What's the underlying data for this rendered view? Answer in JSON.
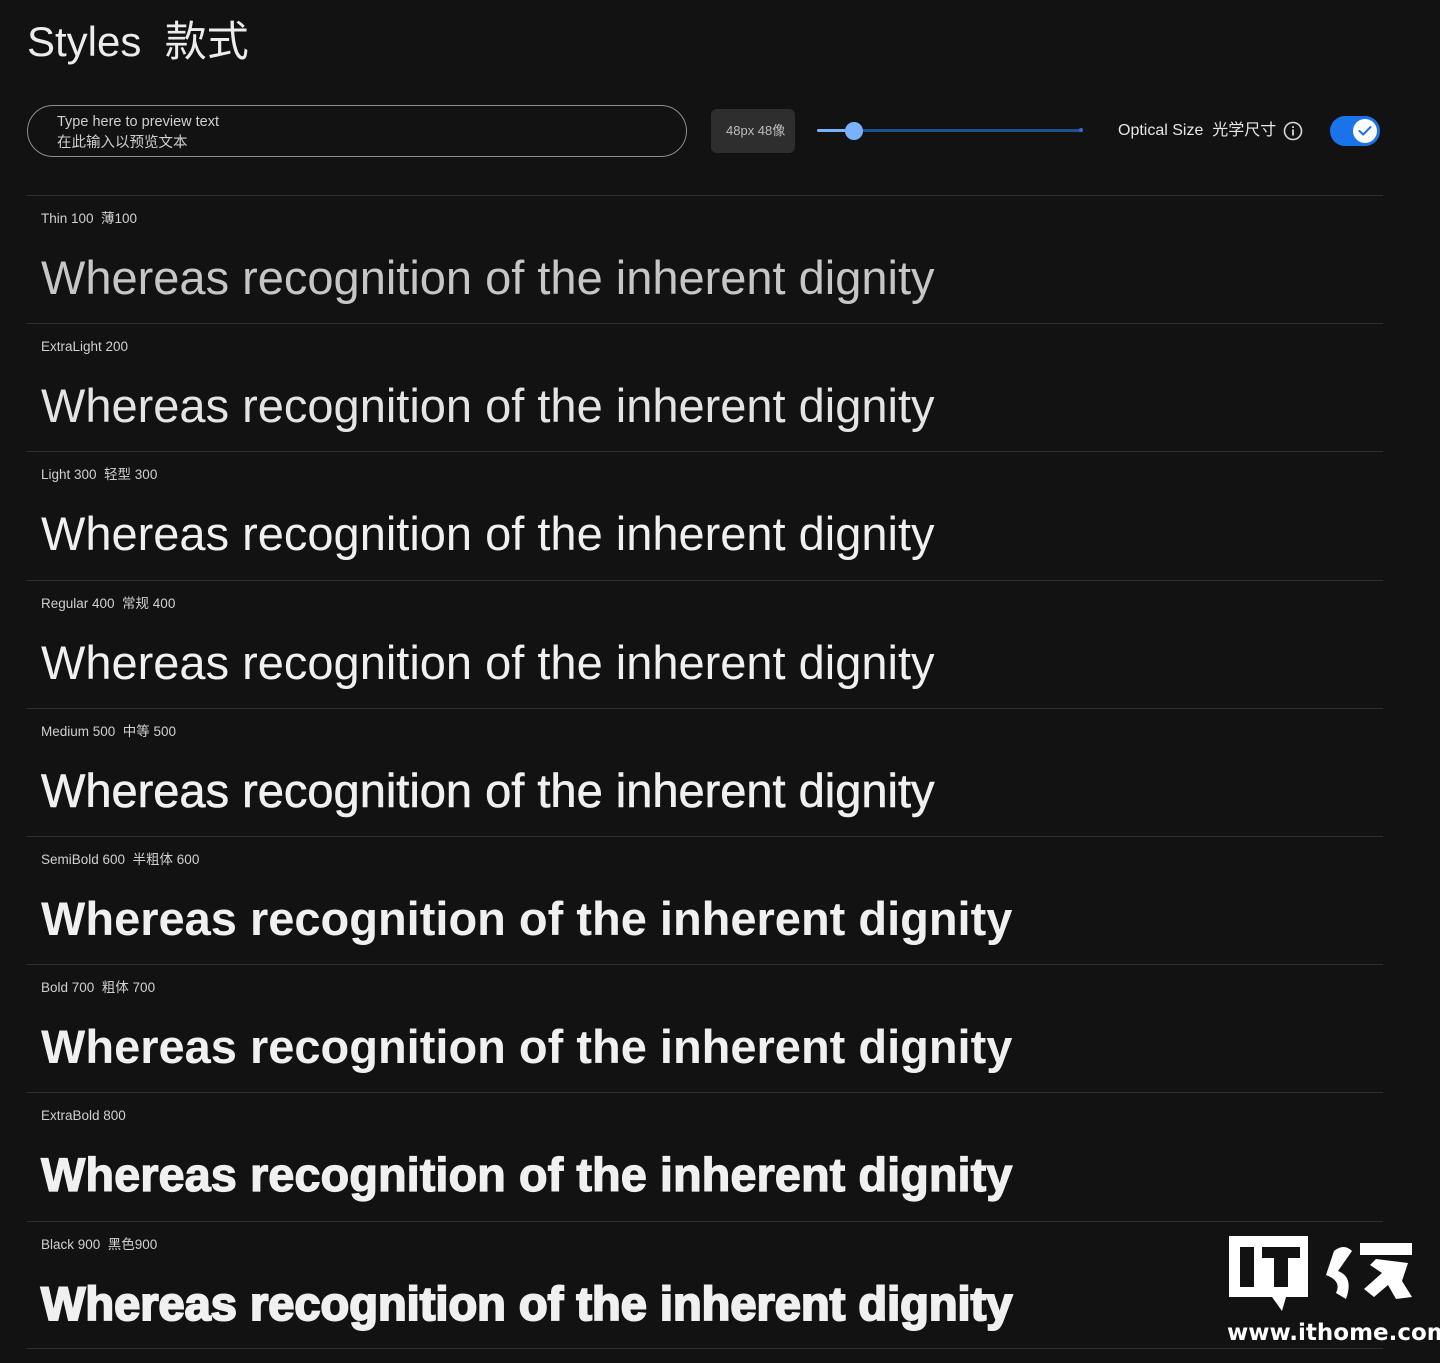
{
  "header": {
    "title": "Styles  款式"
  },
  "controls": {
    "preview_placeholder_line1": "Type here to preview text",
    "preview_placeholder_line2": "在此输入以预览文本",
    "size_value": "48px  48像",
    "slider_value_fraction": 0.14,
    "optical_size_label": "Optical Size  光学尺寸",
    "optical_size_enabled": true
  },
  "colors": {
    "background": "#121212",
    "accent": "#1a73e8",
    "slider_active": "#7ab1ff",
    "slider_track": "#1f4f8f"
  },
  "icons": {
    "info": "info-circle-icon",
    "toggle_check": "check-icon"
  },
  "sample_text": "Whereas recognition of the inherent dignity",
  "styles": [
    {
      "label": "Thin 100  薄100",
      "weight": 100
    },
    {
      "label": "ExtraLight 200",
      "weight": 200
    },
    {
      "label": "Light 300  轻型 300",
      "weight": 300
    },
    {
      "label": "Regular 400  常规 400",
      "weight": 400
    },
    {
      "label": "Medium 500  中等 500",
      "weight": 500
    },
    {
      "label": "SemiBold 600  半粗体 600",
      "weight": 600
    },
    {
      "label": "Bold 700  粗体 700",
      "weight": 700
    },
    {
      "label": "ExtraBold 800",
      "weight": 800
    },
    {
      "label": "Black 900  黑色900",
      "weight": 900
    }
  ],
  "watermark": {
    "brand": "IT之家",
    "domain": "www.ithome.com"
  }
}
